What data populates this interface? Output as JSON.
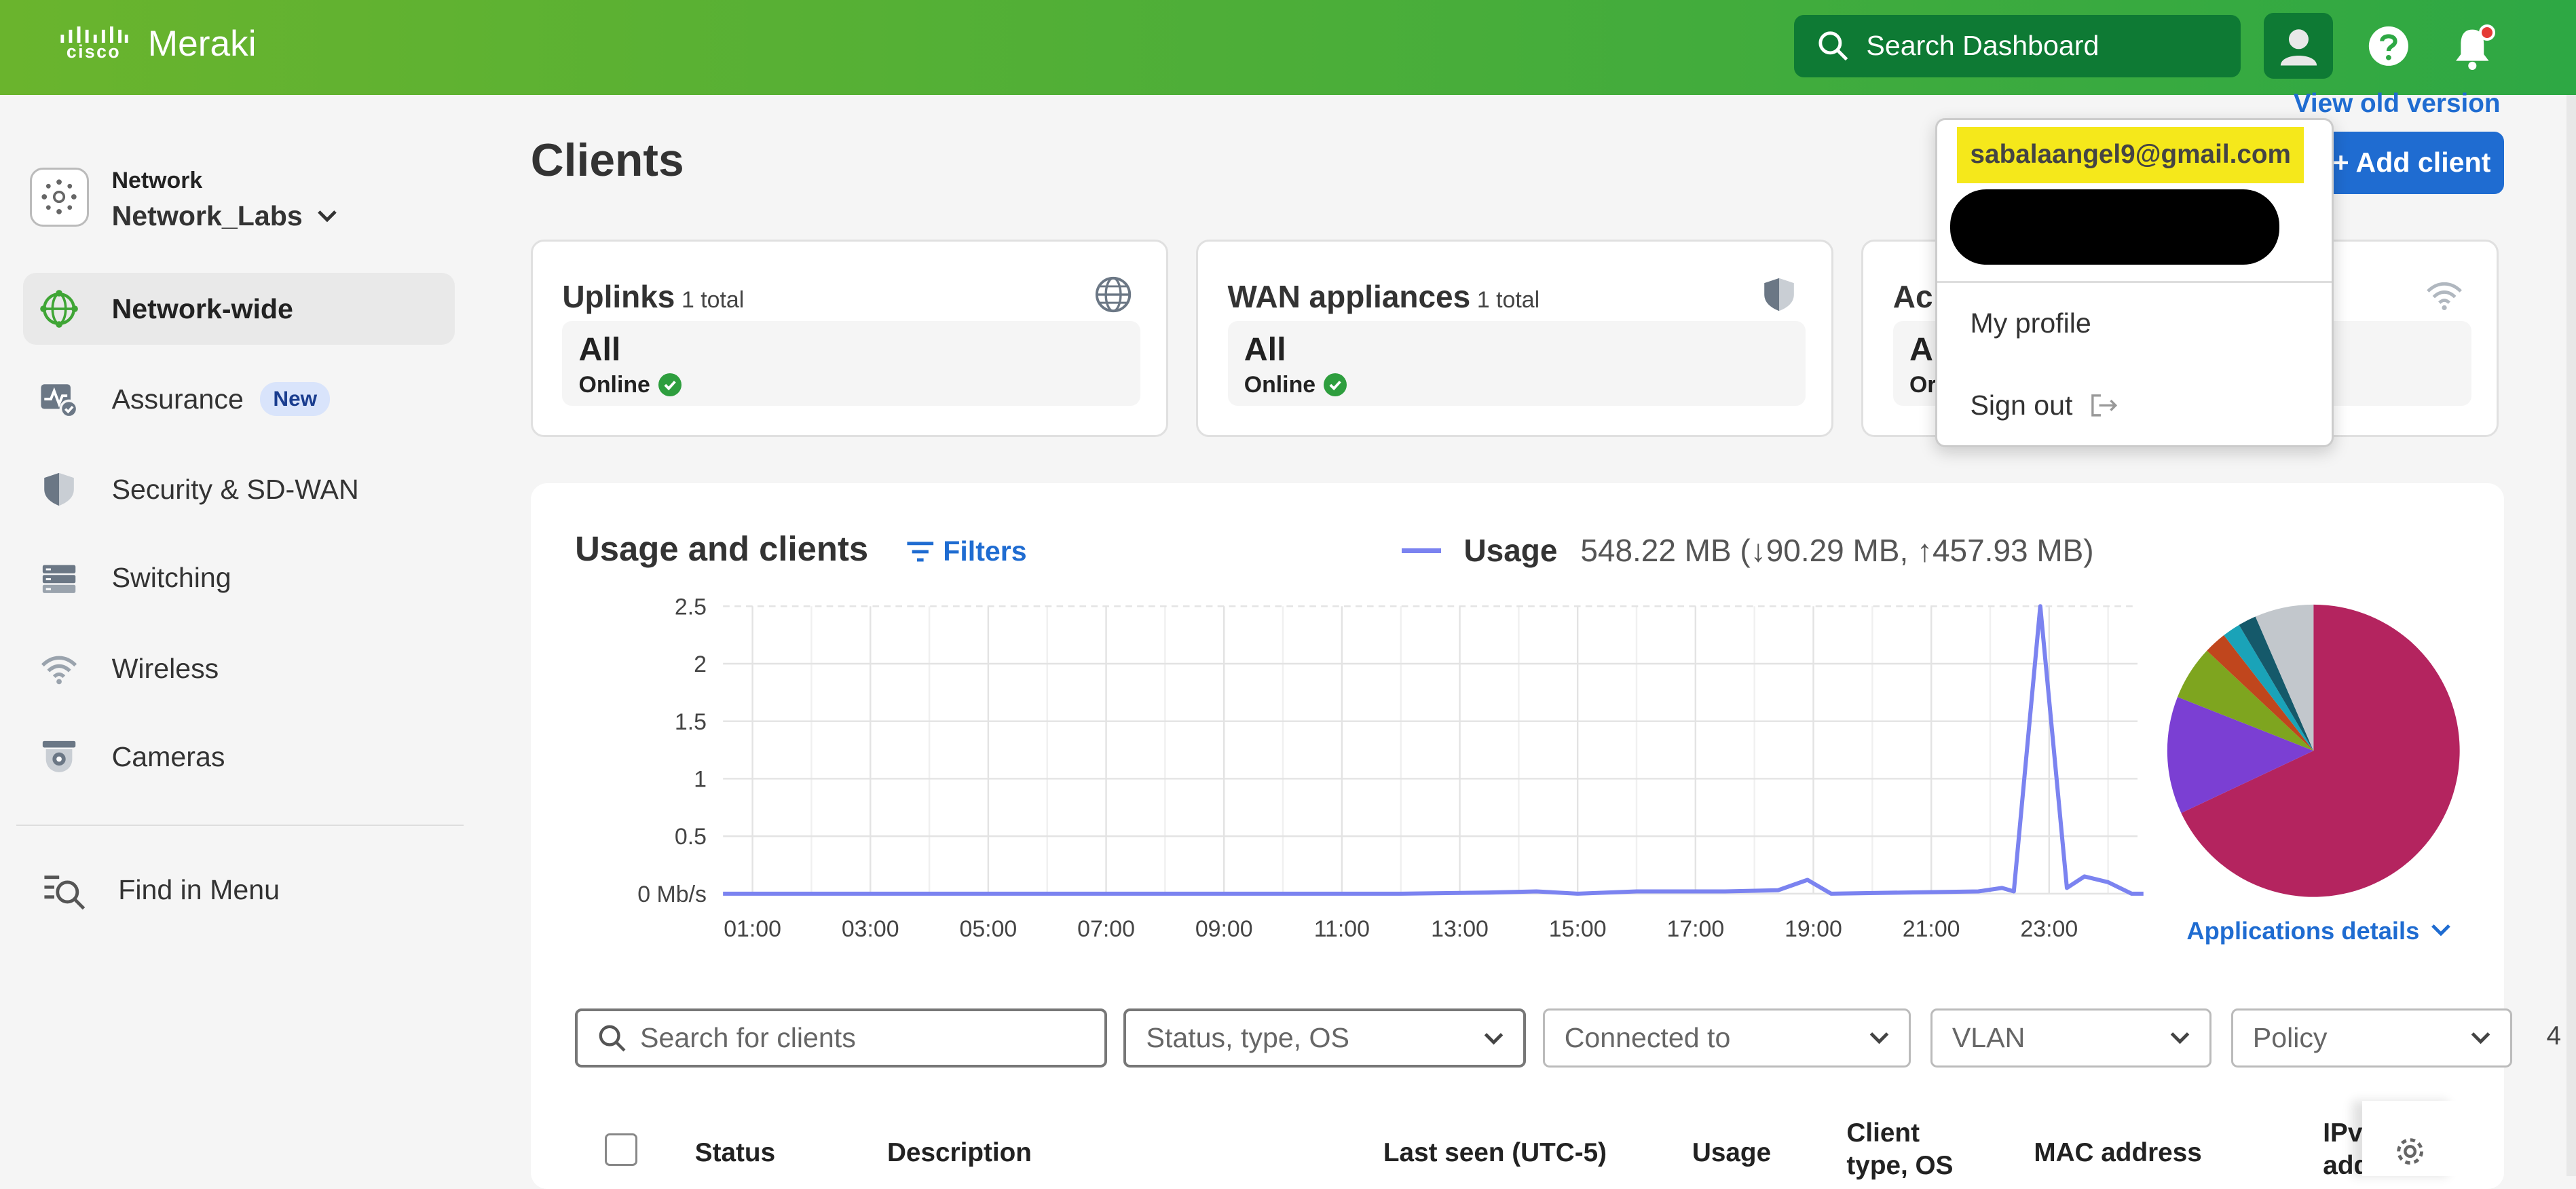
{
  "header": {
    "logo_cisco": "cisco",
    "logo_product": "Meraki",
    "search_placeholder": "Search Dashboard"
  },
  "sidebar": {
    "network_label": "Network",
    "network_name": "Network_Labs",
    "items": [
      {
        "label": "Network-wide",
        "icon": "globe-network-icon",
        "active": true
      },
      {
        "label": "Assurance",
        "icon": "assurance-icon",
        "badge": "New"
      },
      {
        "label": "Security & SD-WAN",
        "icon": "shield-icon"
      },
      {
        "label": "Switching",
        "icon": "switch-icon"
      },
      {
        "label": "Wireless",
        "icon": "wifi-icon"
      },
      {
        "label": "Cameras",
        "icon": "camera-icon"
      }
    ],
    "find_menu": "Find in Menu"
  },
  "main": {
    "title": "Clients",
    "view_old": "View old version",
    "add_client": "+ Add client",
    "cards": [
      {
        "title": "Uplinks",
        "total": "1 total",
        "value": "All",
        "status": "Online",
        "icon": "globe-icon"
      },
      {
        "title": "WAN appliances",
        "total": "1 total",
        "value": "All",
        "status": "Online",
        "icon": "shield-icon"
      },
      {
        "title": "Ac",
        "total": "",
        "value": "A",
        "status": "Or",
        "icon": "wifi-icon"
      }
    ]
  },
  "usage": {
    "title": "Usage and clients",
    "filters": "Filters",
    "legend_name": "Usage",
    "legend_value": "548.22 MB (↓90.29 MB, ↑457.93 MB)",
    "app_details": "Applications details"
  },
  "chart_data": {
    "type": "line",
    "ylabel_unit": "Mb/s",
    "yticks": [
      "0 Mb/s",
      "0.5",
      "1",
      "1.5",
      "2",
      "2.5"
    ],
    "xticks": [
      "01:00",
      "03:00",
      "05:00",
      "07:00",
      "09:00",
      "11:00",
      "13:00",
      "15:00",
      "17:00",
      "19:00",
      "21:00",
      "23:00"
    ],
    "ylim": [
      0,
      2.5
    ],
    "xlim": [
      0,
      24
    ],
    "series": [
      {
        "color": "#7b83f0",
        "points": [
          [
            0.5,
            0
          ],
          [
            12,
            0
          ],
          [
            13.5,
            0.01
          ],
          [
            14.3,
            0.02
          ],
          [
            15,
            0
          ],
          [
            16,
            0.02
          ],
          [
            17.5,
            0.02
          ],
          [
            18.4,
            0.03
          ],
          [
            18.9,
            0.12
          ],
          [
            19.3,
            0
          ],
          [
            21.8,
            0.02
          ],
          [
            22.2,
            0.05
          ],
          [
            22.4,
            0.02
          ],
          [
            22.85,
            2.5
          ],
          [
            23.3,
            0.05
          ],
          [
            23.6,
            0.15
          ],
          [
            24,
            0.1
          ],
          [
            24.4,
            0
          ],
          [
            24.6,
            0
          ]
        ]
      }
    ]
  },
  "pie_data": {
    "type": "pie",
    "slices": [
      {
        "value": 68,
        "color": "#b4245f"
      },
      {
        "value": 13,
        "color": "#7b3fd3"
      },
      {
        "value": 6,
        "color": "#7ea51f"
      },
      {
        "value": 2.5,
        "color": "#c0461d"
      },
      {
        "value": 2,
        "color": "#1aa3b8"
      },
      {
        "value": 2,
        "color": "#15596a"
      },
      {
        "value": 6.5,
        "color": "#c2c7cc"
      }
    ]
  },
  "filters_row": {
    "search_placeholder": "Search for clients",
    "status": "Status, type, OS",
    "connected": "Connected to",
    "vlan": "VLAN",
    "policy": "Policy",
    "count": "4"
  },
  "table": {
    "headers": [
      "Status",
      "Description",
      "Last seen (UTC-5)",
      "Usage",
      "Client type, OS",
      "MAC address",
      "IPv addr"
    ]
  },
  "dropdown": {
    "email": "sabalaangel9@gmail.com",
    "my_profile": "My profile",
    "sign_out": "Sign out"
  }
}
